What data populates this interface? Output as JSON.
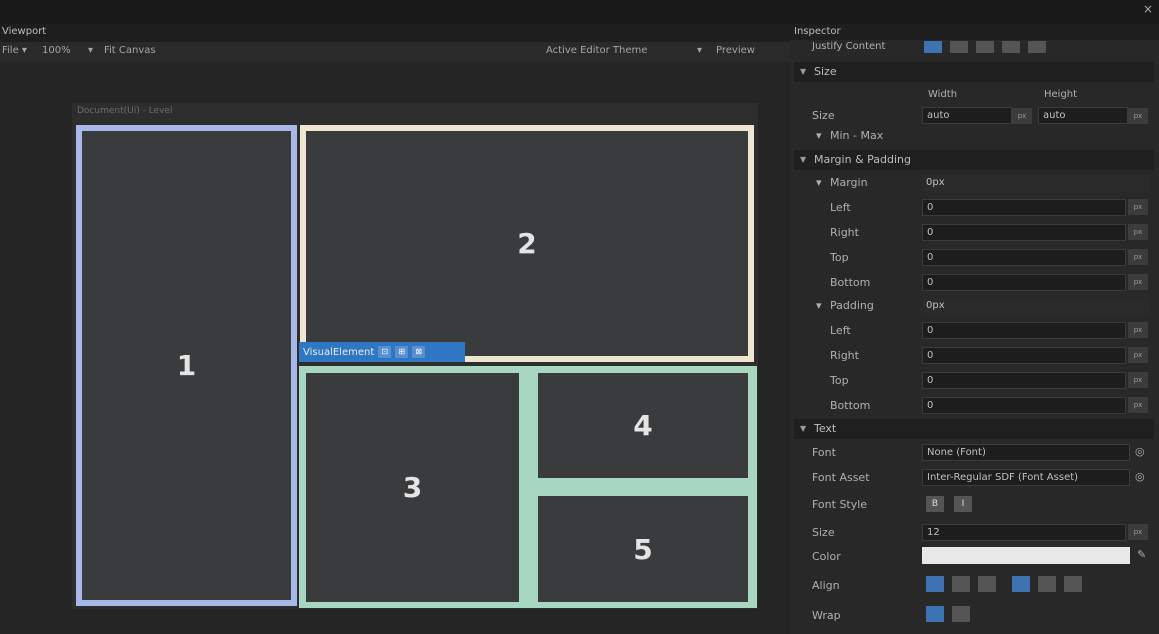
{
  "window": {
    "close_glyph": "×"
  },
  "viewport": {
    "title": "Viewport",
    "toolbar": {
      "file": "File ▾",
      "zoom": "100%",
      "fit": "Fit Canvas",
      "theme": "Active Editor Theme",
      "preview": "Preview"
    },
    "document_label": "Document(Ui) - Level",
    "boxes": [
      "1",
      "2",
      "3",
      "4",
      "5"
    ],
    "selected_tag": {
      "label": "VisualElement",
      "icons": [
        "⊡",
        "⊞",
        "⊠"
      ]
    }
  },
  "inspector": {
    "title": "Inspector",
    "justify_label": "Justify Content",
    "size": {
      "header": "Size",
      "width_col": "Width",
      "height_col": "Height",
      "label": "Size",
      "width": "auto",
      "height": "auto",
      "minmax": "Min - Max"
    },
    "margin_padding": {
      "header": "Margin & Padding",
      "margin": {
        "label": "Margin",
        "summary": "0px"
      },
      "margin_rows": [
        {
          "label": "Left",
          "value": "0"
        },
        {
          "label": "Right",
          "value": "0"
        },
        {
          "label": "Top",
          "value": "0"
        },
        {
          "label": "Bottom",
          "value": "0"
        }
      ],
      "padding": {
        "label": "Padding",
        "summary": "0px"
      },
      "padding_rows": [
        {
          "label": "Left",
          "value": "0"
        },
        {
          "label": "Right",
          "value": "0"
        },
        {
          "label": "Top",
          "value": "0"
        },
        {
          "label": "Bottom",
          "value": "0"
        }
      ]
    },
    "text": {
      "header": "Text",
      "font_label": "Font",
      "font_value": "None (Font)",
      "font_asset_label": "Font Asset",
      "font_asset_value": "Inter-Regular SDF (Font Asset)",
      "style_label": "Font Style",
      "style_buttons": [
        "B",
        "I"
      ],
      "size_label": "Size",
      "size_value": "12",
      "color_label": "Color",
      "color_value": "#e8e8e8",
      "align_label": "Align",
      "wrap_label": "Wrap"
    },
    "unit_glyph": "px"
  }
}
